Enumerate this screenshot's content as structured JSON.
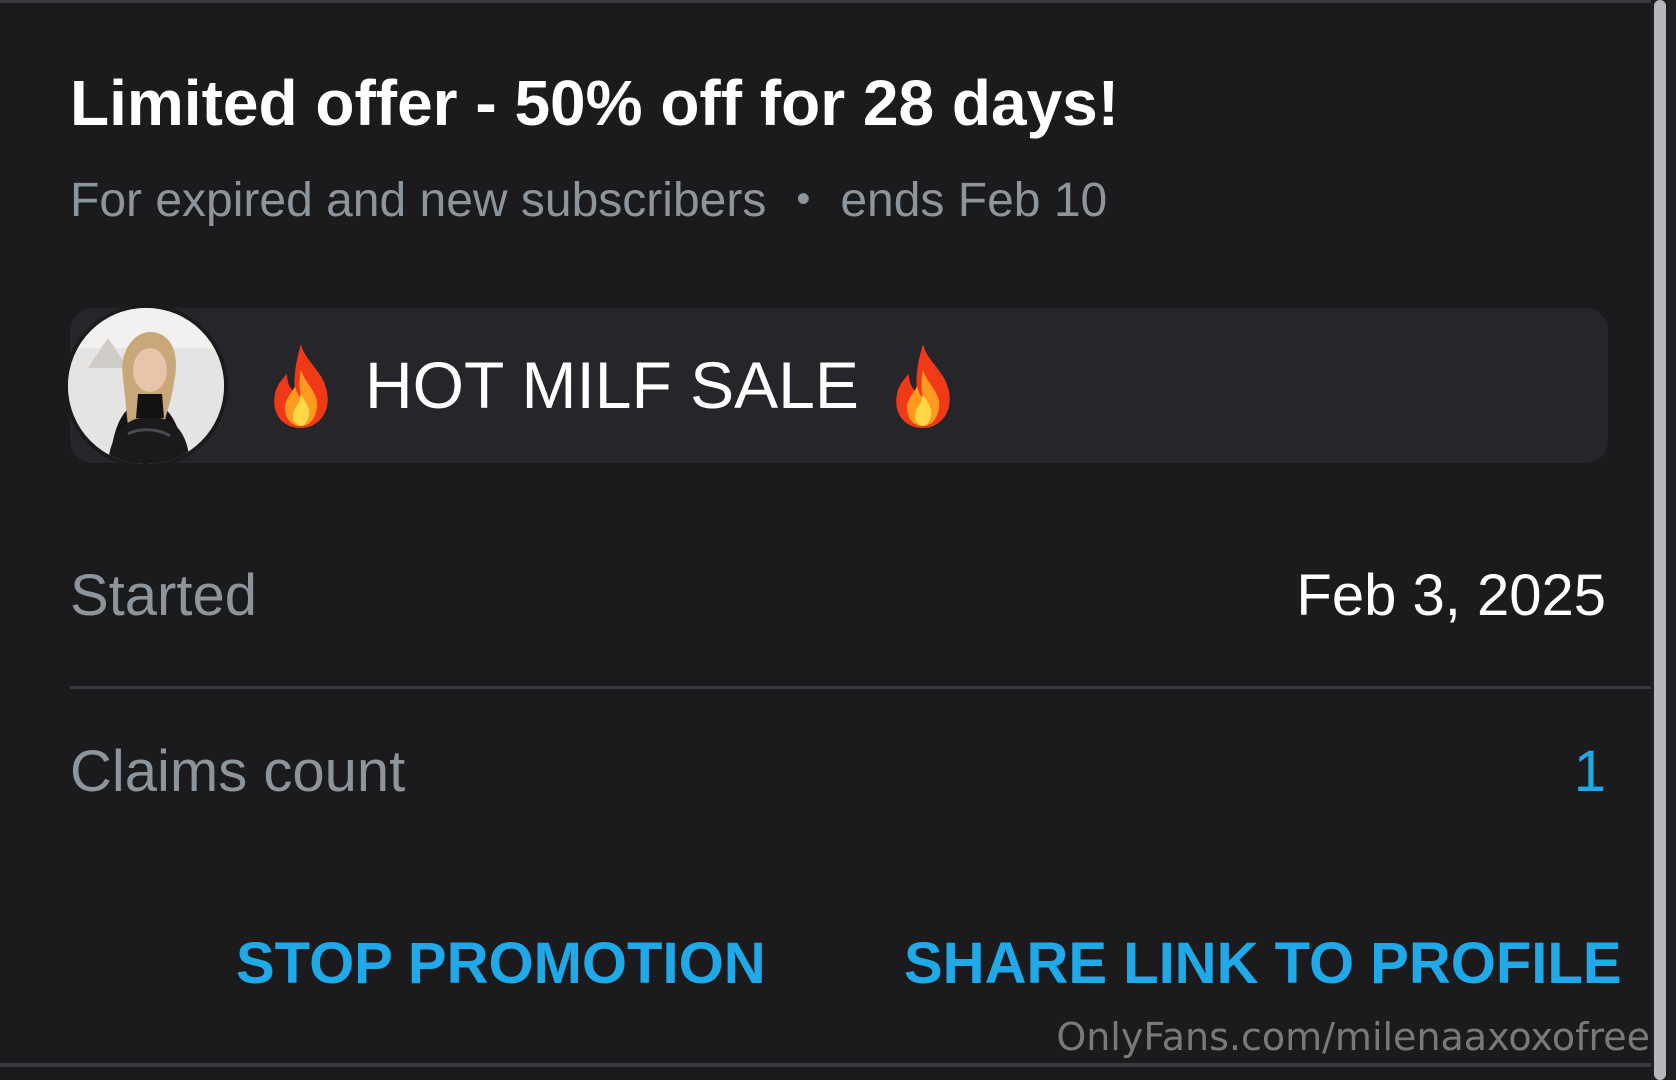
{
  "offer": {
    "title": "Limited offer - 50% off for 28 days!",
    "audience": "For expired and new subscribers",
    "separator": "•",
    "ends": "ends Feb 10"
  },
  "banner": {
    "avatar": "avatar-photo",
    "fire_icon": "fire-icon",
    "text": "HOT MILF SALE"
  },
  "details": {
    "started_label": "Started",
    "started_value": "Feb 3, 2025",
    "claims_label": "Claims count",
    "claims_value": "1"
  },
  "actions": {
    "stop_label": "STOP PROMOTION",
    "share_label": "SHARE LINK TO PROFILE"
  },
  "watermark": "OnlyFans.com/milenaaxoxofree",
  "colors": {
    "background": "#1b1b1e",
    "banner": "#26262a",
    "accent": "#1fa9e8",
    "muted_text": "#8e949c"
  }
}
